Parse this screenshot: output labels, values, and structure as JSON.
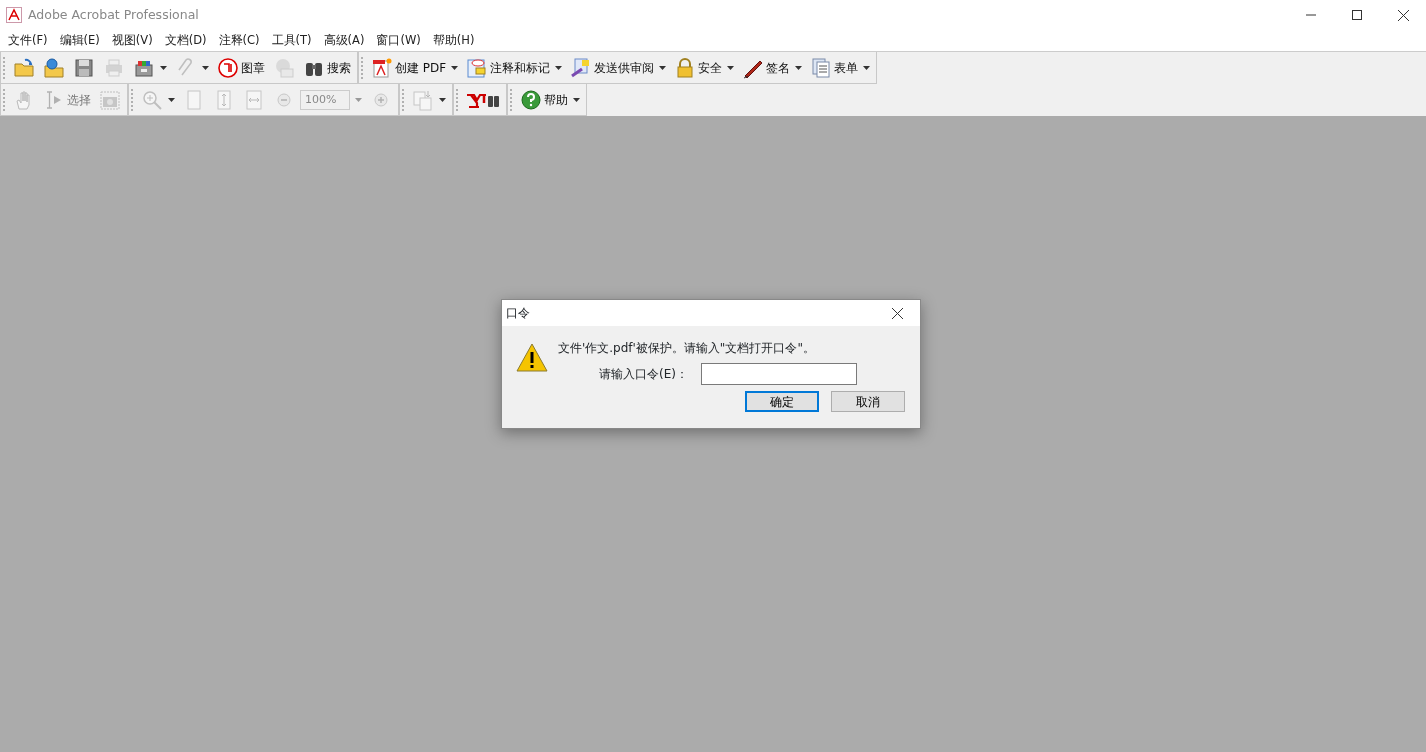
{
  "window": {
    "title": "Adobe Acrobat Professional"
  },
  "menu": [
    "文件(F)",
    "编辑(E)",
    "视图(V)",
    "文档(D)",
    "注释(C)",
    "工具(T)",
    "高级(A)",
    "窗口(W)",
    "帮助(H)"
  ],
  "toolbars": [
    {
      "groups": [
        {
          "items": [
            {
              "kind": "button",
              "disabled": false,
              "dropdown": false
            },
            {
              "kind": "button",
              "disabled": false,
              "dropdown": false
            },
            {
              "kind": "button",
              "disabled": false,
              "dropdown": false
            },
            {
              "kind": "button",
              "disabled": true,
              "dropdown": false
            },
            {
              "kind": "button",
              "disabled": false,
              "dropdown": true
            },
            {
              "kind": "button",
              "disabled": true,
              "dropdown": true
            },
            {
              "kind": "button",
              "label": "图章",
              "disabled": false,
              "dropdown": false
            },
            {
              "kind": "button",
              "disabled": true,
              "dropdown": false
            },
            {
              "kind": "button",
              "label": "搜索",
              "disabled": false,
              "dropdown": false
            }
          ]
        },
        {
          "items": [
            {
              "kind": "button",
              "label": "创建 PDF",
              "disabled": false,
              "dropdown": true
            },
            {
              "kind": "button",
              "label": "注释和标记",
              "disabled": false,
              "dropdown": true
            },
            {
              "kind": "button",
              "label": "发送供审阅",
              "disabled": false,
              "dropdown": true
            },
            {
              "kind": "button",
              "label": "安全",
              "disabled": false,
              "dropdown": true
            },
            {
              "kind": "button",
              "label": "签名",
              "disabled": false,
              "dropdown": true
            },
            {
              "kind": "button",
              "label": "表单",
              "disabled": false,
              "dropdown": true
            }
          ]
        }
      ]
    },
    {
      "groups": [
        {
          "items": [
            {
              "kind": "button",
              "disabled": true,
              "dropdown": false
            },
            {
              "kind": "button",
              "label": "选择",
              "disabled": true,
              "dropdown": false
            },
            {
              "kind": "button",
              "disabled": true,
              "dropdown": false
            }
          ]
        },
        {
          "items": [
            {
              "kind": "button",
              "disabled": true,
              "dropdown": true
            },
            {
              "kind": "button",
              "disabled": true,
              "dropdown": false
            },
            {
              "kind": "button",
              "disabled": true,
              "dropdown": false
            },
            {
              "kind": "button",
              "disabled": true,
              "dropdown": false
            },
            {
              "kind": "button",
              "disabled": true,
              "dropdown": false
            },
            {
              "kind": "field",
              "value": "100%",
              "disabled": true,
              "dropdown": true
            },
            {
              "kind": "button",
              "disabled": true,
              "dropdown": false
            }
          ]
        },
        {
          "items": [
            {
              "kind": "button",
              "disabled": true,
              "dropdown": true
            }
          ]
        },
        {
          "items": [
            {
              "kind": "button",
              "disabled": false,
              "dropdown": false
            }
          ]
        },
        {
          "items": [
            {
              "kind": "button",
              "label": "帮助",
              "disabled": false,
              "dropdown": true
            }
          ]
        }
      ]
    }
  ],
  "dialog": {
    "title": "口令",
    "message": "文件'作文.pdf'被保护。请输入\"文档打开口令\"。",
    "field_label": "请输入口令(E)：",
    "buttons": [
      {
        "label": "确定",
        "default": true
      },
      {
        "label": "取消",
        "default": false
      }
    ]
  }
}
